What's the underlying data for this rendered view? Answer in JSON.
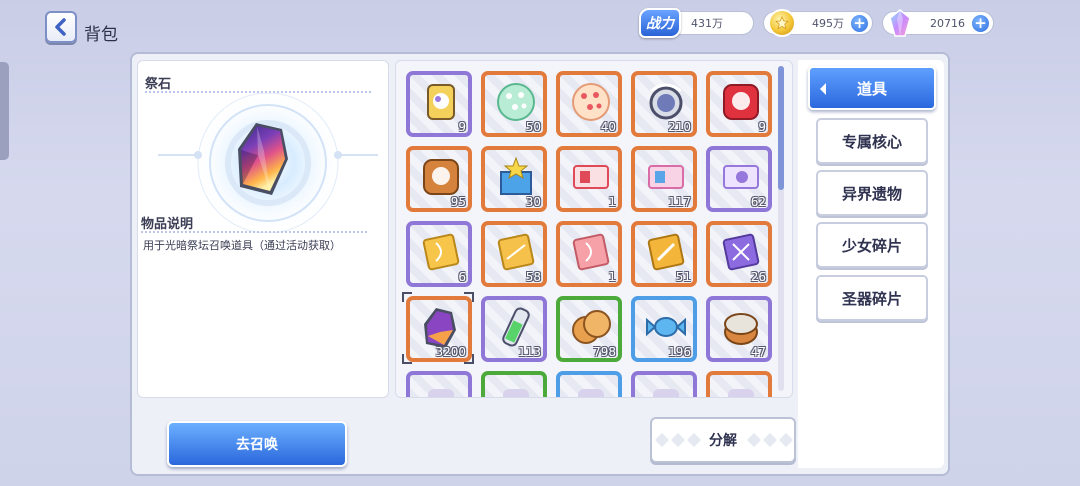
{
  "header": {
    "title": "背包",
    "power_badge": "战力",
    "power_value": "431万",
    "gold_value": "495万",
    "gem_value": "20716",
    "plus_label": "+"
  },
  "detail": {
    "item_name": "祭石",
    "desc_title": "物品说明",
    "desc_text": "用于光暗祭坛召唤道具（通过活动获取）"
  },
  "items": [
    {
      "count": "9",
      "rarity": "purple",
      "icon": "soul-can-icon"
    },
    {
      "count": "50",
      "rarity": "orange",
      "icon": "green-cookie-icon"
    },
    {
      "count": "40",
      "rarity": "orange",
      "icon": "pink-cookie-icon"
    },
    {
      "count": "210",
      "rarity": "orange",
      "icon": "bell-lens-icon"
    },
    {
      "count": "9",
      "rarity": "orange",
      "icon": "red-soul-box-icon"
    },
    {
      "count": "95",
      "rarity": "orange",
      "icon": "bronze-soul-box-icon"
    },
    {
      "count": "30",
      "rarity": "orange",
      "icon": "gift-box-icon"
    },
    {
      "count": "1",
      "rarity": "orange",
      "icon": "red-ticket-icon"
    },
    {
      "count": "117",
      "rarity": "orange",
      "icon": "pink-ticket-icon"
    },
    {
      "count": "62",
      "rarity": "purple",
      "icon": "smile-ticket-icon"
    },
    {
      "count": "6",
      "rarity": "purple",
      "icon": "gold-dna-card-icon"
    },
    {
      "count": "58",
      "rarity": "orange",
      "icon": "gold-card-icon"
    },
    {
      "count": "1",
      "rarity": "orange",
      "icon": "pink-dna-card-icon"
    },
    {
      "count": "51",
      "rarity": "orange",
      "icon": "gold-sword-card-icon"
    },
    {
      "count": "26",
      "rarity": "orange",
      "icon": "purple-sword-card-icon"
    },
    {
      "count": "3200",
      "rarity": "orange",
      "icon": "altar-stone-icon"
    },
    {
      "count": "113",
      "rarity": "purple",
      "icon": "green-tube-icon"
    },
    {
      "count": "798",
      "rarity": "green",
      "icon": "biscuit-icon"
    },
    {
      "count": "196",
      "rarity": "blue",
      "icon": "candy-icon"
    },
    {
      "count": "47",
      "rarity": "purple",
      "icon": "tin-can-icon"
    },
    {
      "count": "",
      "rarity": "purple",
      "icon": "partial-item-icon"
    },
    {
      "count": "",
      "rarity": "green",
      "icon": "partial-item-icon"
    },
    {
      "count": "",
      "rarity": "blue",
      "icon": "partial-item-icon"
    },
    {
      "count": "",
      "rarity": "purple",
      "icon": "partial-item-icon"
    },
    {
      "count": "",
      "rarity": "orange",
      "icon": "partial-item-icon"
    }
  ],
  "tabs": {
    "active": "道具",
    "items": [
      "专属核心",
      "异界遗物",
      "少女碎片",
      "圣器碎片"
    ]
  },
  "buttons": {
    "summon": "去召唤",
    "decompose": "分解"
  },
  "colors": {
    "accent_blue": "#2c68de",
    "rarity_purple": "#8f77d8",
    "rarity_orange": "#e27a3c",
    "rarity_green": "#4caa3a",
    "rarity_blue": "#4d9ee6"
  }
}
